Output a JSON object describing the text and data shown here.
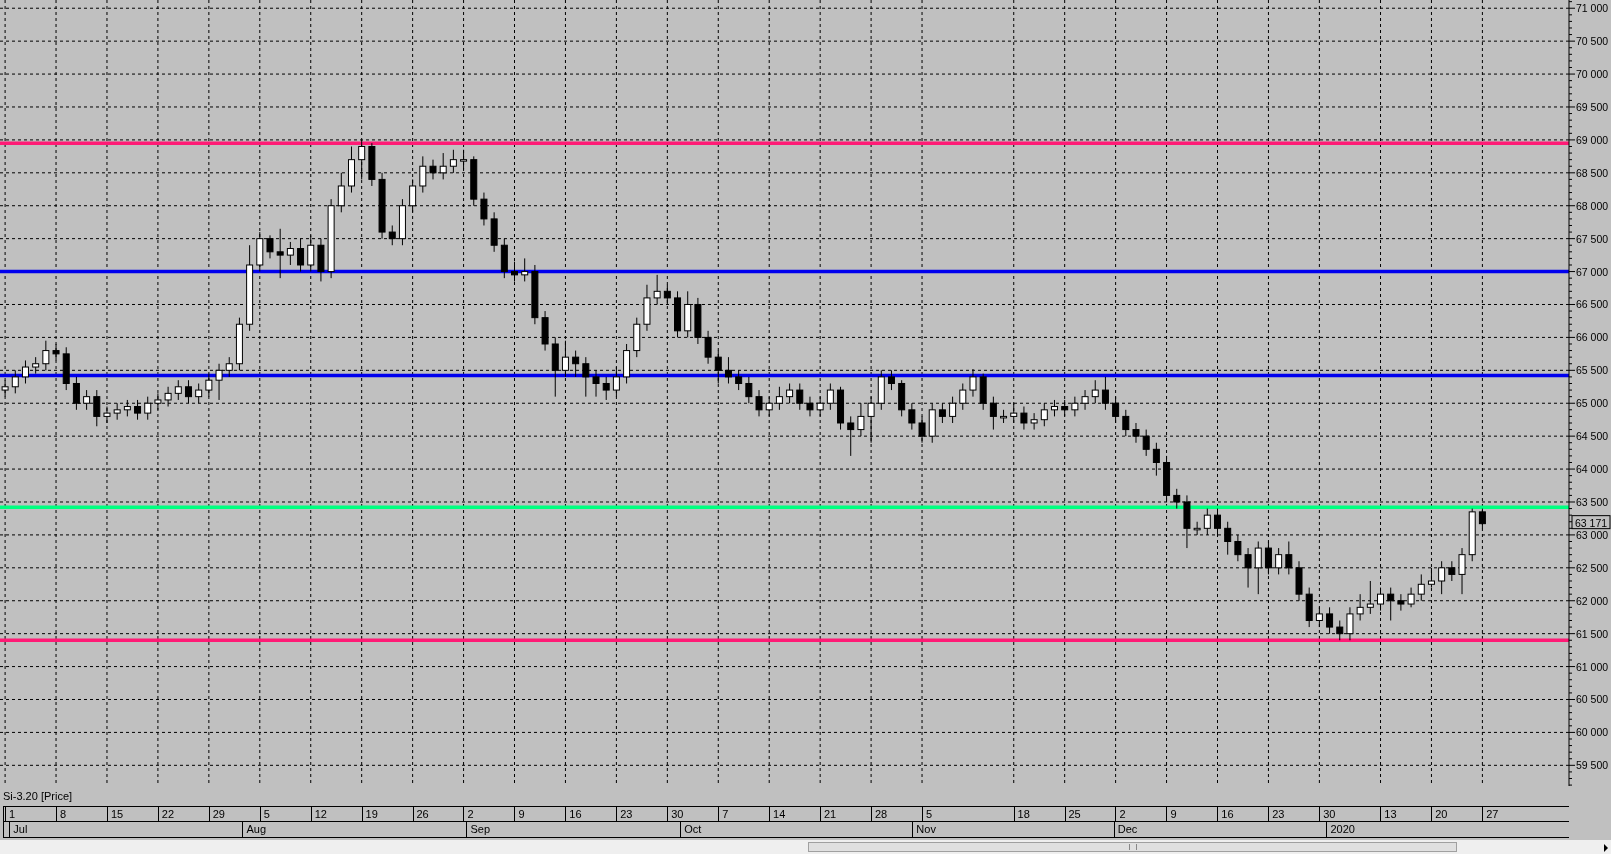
{
  "chart": {
    "chart_data": {
      "type": "candlestick",
      "categories": [
        null,
        null,
        null,
        null,
        null,
        null,
        null,
        null,
        null,
        null,
        null,
        null,
        null,
        null,
        null,
        null,
        null,
        null,
        null,
        null,
        null,
        null,
        null,
        null,
        null,
        null,
        null,
        null,
        null,
        null,
        null,
        null,
        null,
        null,
        null,
        null,
        null,
        null,
        null,
        null,
        null,
        null,
        null,
        null,
        null,
        null,
        null,
        null,
        null,
        null,
        null,
        null,
        null,
        null,
        null,
        null,
        null,
        null,
        null,
        null,
        null,
        null,
        null,
        null,
        null,
        null,
        null,
        null,
        null,
        null,
        null,
        null,
        null,
        null,
        null,
        null,
        null,
        null,
        null,
        null,
        null,
        null,
        null,
        null,
        null,
        null,
        null,
        null,
        null,
        null,
        null,
        null,
        null,
        null,
        null,
        null,
        null,
        null,
        null,
        null,
        null,
        null,
        null,
        null,
        null,
        null,
        null,
        null,
        null,
        null,
        null,
        null,
        null,
        null,
        null,
        null,
        null,
        null,
        null,
        null,
        null,
        null,
        null,
        null,
        null,
        null,
        null,
        null,
        null,
        null,
        null,
        null,
        null,
        null,
        null,
        null,
        null,
        null,
        null,
        null,
        null,
        null,
        null,
        null,
        null,
        null,
        null,
        null,
        null,
        null,
        null,
        null,
        null,
        null
      ],
      "ohlc": [
        [
          65200,
          65350,
          65100,
          65250
        ],
        [
          65250,
          65500,
          65150,
          65400
        ],
        [
          65400,
          65650,
          65300,
          65550
        ],
        [
          65550,
          65700,
          65450,
          65600
        ],
        [
          65600,
          65950,
          65500,
          65800
        ],
        [
          65800,
          65900,
          65650,
          65750
        ],
        [
          65750,
          65850,
          65200,
          65300
        ],
        [
          65300,
          65400,
          64900,
          65000
        ],
        [
          65000,
          65200,
          64900,
          65100
        ],
        [
          65100,
          65200,
          64650,
          64800
        ],
        [
          64800,
          64950,
          64700,
          64850
        ],
        [
          64850,
          65000,
          64750,
          64900
        ],
        [
          64900,
          65050,
          64800,
          64950
        ],
        [
          64950,
          65050,
          64750,
          64850
        ],
        [
          64850,
          65100,
          64750,
          65000
        ],
        [
          65000,
          65150,
          64900,
          65050
        ],
        [
          65050,
          65250,
          64950,
          65150
        ],
        [
          65150,
          65350,
          65050,
          65250
        ],
        [
          65250,
          65350,
          65000,
          65100
        ],
        [
          65100,
          65300,
          65000,
          65200
        ],
        [
          65200,
          65450,
          65100,
          65350
        ],
        [
          65350,
          65600,
          65050,
          65500
        ],
        [
          65500,
          65700,
          65400,
          65600
        ],
        [
          65600,
          66300,
          65500,
          66200
        ],
        [
          66200,
          67400,
          66100,
          67100
        ],
        [
          67100,
          67600,
          67000,
          67500
        ],
        [
          67500,
          67550,
          67200,
          67300
        ],
        [
          67300,
          67650,
          66900,
          67250
        ],
        [
          67250,
          67450,
          67100,
          67350
        ],
        [
          67350,
          67500,
          67000,
          67100
        ],
        [
          67100,
          67550,
          67000,
          67400
        ],
        [
          67400,
          67500,
          66850,
          67000
        ],
        [
          67000,
          68100,
          66900,
          68000
        ],
        [
          68000,
          68500,
          67900,
          68300
        ],
        [
          68300,
          68900,
          68200,
          68700
        ],
        [
          68700,
          69000,
          68400,
          68900
        ],
        [
          68900,
          68950,
          68300,
          68400
        ],
        [
          68400,
          68500,
          67500,
          67600
        ],
        [
          67600,
          67700,
          67400,
          67500
        ],
        [
          67500,
          68100,
          67400,
          68000
        ],
        [
          68000,
          68400,
          67900,
          68300
        ],
        [
          68300,
          68750,
          68200,
          68600
        ],
        [
          68600,
          68700,
          68400,
          68500
        ],
        [
          68500,
          68800,
          68400,
          68600
        ],
        [
          68600,
          68850,
          68500,
          68700
        ],
        [
          68700,
          68850,
          68550,
          68700
        ],
        [
          68700,
          68750,
          68000,
          68100
        ],
        [
          68100,
          68200,
          67700,
          67800
        ],
        [
          67800,
          67900,
          67300,
          67400
        ],
        [
          67400,
          67500,
          66900,
          67000
        ],
        [
          67000,
          67150,
          66850,
          66950
        ],
        [
          66950,
          67200,
          66850,
          67000
        ],
        [
          67000,
          67100,
          66200,
          66300
        ],
        [
          66300,
          66400,
          65800,
          65900
        ],
        [
          65900,
          66000,
          65100,
          65500
        ],
        [
          65500,
          65950,
          65400,
          65700
        ],
        [
          65700,
          65800,
          65400,
          65600
        ],
        [
          65600,
          65700,
          65100,
          65400
        ],
        [
          65400,
          65500,
          65100,
          65300
        ],
        [
          65300,
          65400,
          65050,
          65200
        ],
        [
          65200,
          65550,
          65100,
          65400
        ],
        [
          65400,
          65900,
          65300,
          65800
        ],
        [
          65800,
          66300,
          65700,
          66200
        ],
        [
          66200,
          66800,
          66100,
          66600
        ],
        [
          66600,
          66950,
          66500,
          66700
        ],
        [
          66700,
          66800,
          66500,
          66600
        ],
        [
          66600,
          66700,
          66000,
          66100
        ],
        [
          66100,
          66700,
          66000,
          66500
        ],
        [
          66500,
          66600,
          65900,
          66000
        ],
        [
          66000,
          66100,
          65600,
          65700
        ],
        [
          65700,
          65800,
          65300,
          65500
        ],
        [
          65500,
          65700,
          65300,
          65400
        ],
        [
          65400,
          65500,
          65200,
          65300
        ],
        [
          65300,
          65400,
          65000,
          65100
        ],
        [
          65100,
          65200,
          64800,
          64900
        ],
        [
          64900,
          65100,
          64800,
          65000
        ],
        [
          65000,
          65250,
          64900,
          65100
        ],
        [
          65100,
          65300,
          65000,
          65200
        ],
        [
          65200,
          65300,
          64900,
          65000
        ],
        [
          65000,
          65100,
          64800,
          64900
        ],
        [
          64900,
          65100,
          64800,
          65000
        ],
        [
          65000,
          65300,
          64900,
          65200
        ],
        [
          65200,
          65250,
          64600,
          64700
        ],
        [
          64700,
          64800,
          64200,
          64600
        ],
        [
          64600,
          65000,
          64500,
          64800
        ],
        [
          64800,
          65100,
          64400,
          65000
        ],
        [
          65000,
          65500,
          64900,
          65400
        ],
        [
          65400,
          65500,
          65200,
          65300
        ],
        [
          65300,
          65350,
          64800,
          64900
        ],
        [
          64900,
          65000,
          64600,
          64700
        ],
        [
          64700,
          64800,
          64400,
          64500
        ],
        [
          64500,
          65000,
          64400,
          64900
        ],
        [
          64900,
          65000,
          64700,
          64800
        ],
        [
          64800,
          65100,
          64700,
          65000
        ],
        [
          65000,
          65300,
          64900,
          65200
        ],
        [
          65200,
          65520,
          65100,
          65400
        ],
        [
          65400,
          65450,
          64900,
          65000
        ],
        [
          65000,
          65100,
          64600,
          64800
        ],
        [
          64800,
          64900,
          64700,
          64800
        ],
        [
          64800,
          65000,
          64700,
          64850
        ],
        [
          64850,
          64950,
          64600,
          64700
        ],
        [
          64700,
          64850,
          64600,
          64750
        ],
        [
          64750,
          65000,
          64650,
          64900
        ],
        [
          64900,
          65050,
          64800,
          64950
        ],
        [
          64950,
          65050,
          64800,
          64900
        ],
        [
          64900,
          65100,
          64800,
          65000
        ],
        [
          65000,
          65200,
          64900,
          65100
        ],
        [
          65100,
          65350,
          65000,
          65200
        ],
        [
          65200,
          65400,
          64900,
          65000
        ],
        [
          65000,
          65100,
          64700,
          64800
        ],
        [
          64800,
          64900,
          64500,
          64600
        ],
        [
          64600,
          64700,
          64400,
          64500
        ],
        [
          64500,
          64600,
          64200,
          64300
        ],
        [
          64300,
          64400,
          63900,
          64100
        ],
        [
          64100,
          64200,
          63500,
          63600
        ],
        [
          63600,
          63700,
          63400,
          63500
        ],
        [
          63500,
          63600,
          62800,
          63100
        ],
        [
          63100,
          63200,
          63000,
          63100
        ],
        [
          63100,
          63400,
          63000,
          63300
        ],
        [
          63300,
          63400,
          63000,
          63100
        ],
        [
          63100,
          63200,
          62700,
          62900
        ],
        [
          62900,
          63000,
          62600,
          62700
        ],
        [
          62700,
          62800,
          62200,
          62500
        ],
        [
          62500,
          62900,
          62100,
          62800
        ],
        [
          62800,
          62900,
          62400,
          62500
        ],
        [
          62500,
          62800,
          62400,
          62700
        ],
        [
          62700,
          62900,
          62400,
          62500
        ],
        [
          62500,
          62600,
          62000,
          62100
        ],
        [
          62100,
          62200,
          61600,
          61700
        ],
        [
          61700,
          61900,
          61600,
          61800
        ],
        [
          61800,
          61900,
          61500,
          61600
        ],
        [
          61600,
          61700,
          61400,
          61500
        ],
        [
          61500,
          61900,
          61400,
          61800
        ],
        [
          61800,
          62100,
          61700,
          61900
        ],
        [
          61900,
          62300,
          61800,
          61950
        ],
        [
          61950,
          62200,
          61850,
          62100
        ],
        [
          62100,
          62200,
          61700,
          62000
        ],
        [
          62000,
          62100,
          61850,
          61950
        ],
        [
          61950,
          62200,
          61900,
          62100
        ],
        [
          62100,
          62400,
          62000,
          62250
        ],
        [
          62250,
          62500,
          62200,
          62300
        ],
        [
          62300,
          62600,
          62100,
          62500
        ],
        [
          62500,
          62600,
          62300,
          62400
        ],
        [
          62400,
          62800,
          62100,
          62700
        ],
        [
          62700,
          63400,
          62600,
          63350
        ],
        [
          63350,
          63400,
          63100,
          63171
        ],
        null,
        null,
        null,
        null,
        null,
        null,
        null,
        null
      ],
      "ylim": [
        59186,
        71125
      ],
      "grid": true,
      "yticks": [
        {
          "value": 71000,
          "label": "71 000"
        },
        {
          "value": 70500,
          "label": "70 500"
        },
        {
          "value": 70000,
          "label": "70 000"
        },
        {
          "value": 69500,
          "label": "69 500"
        },
        {
          "value": 69000,
          "label": "69 000"
        },
        {
          "value": 68500,
          "label": "68 500"
        },
        {
          "value": 68000,
          "label": "68 000"
        },
        {
          "value": 67500,
          "label": "67 500"
        },
        {
          "value": 67000,
          "label": "67 000"
        },
        {
          "value": 66500,
          "label": "66 500"
        },
        {
          "value": 66000,
          "label": "66 000"
        },
        {
          "value": 65500,
          "label": "65 500"
        },
        {
          "value": 65000,
          "label": "65 000"
        },
        {
          "value": 64500,
          "label": "64 500"
        },
        {
          "value": 64000,
          "label": "64 000"
        },
        {
          "value": 63500,
          "label": "63 500"
        },
        {
          "value": 63000,
          "label": "63 000"
        },
        {
          "value": 62500,
          "label": "62 500"
        },
        {
          "value": 62000,
          "label": "62 000"
        },
        {
          "value": 61500,
          "label": "61 500"
        },
        {
          "value": 61000,
          "label": "61 000"
        },
        {
          "value": 60500,
          "label": "60 500"
        },
        {
          "value": 60000,
          "label": "60 000"
        },
        {
          "value": 59500,
          "label": "59 500"
        }
      ],
      "ref_lines": [
        {
          "axis": "y",
          "value": 68950,
          "color": "#ff1a75"
        },
        {
          "axis": "y",
          "value": 67000,
          "color": "#0000ee"
        },
        {
          "axis": "y",
          "value": 65420,
          "color": "#0000ee"
        },
        {
          "axis": "y",
          "value": 63420,
          "color": "#00ff80"
        },
        {
          "axis": "y",
          "value": 61400,
          "color": "#ff1a75"
        }
      ]
    },
    "days": [
      "1",
      "8",
      "15",
      "22",
      "29",
      "5",
      "12",
      "19",
      "26",
      "2",
      "9",
      "16",
      "23",
      "30",
      "7",
      "14",
      "21",
      "28",
      "5",
      "18",
      "25",
      "2",
      "9",
      "16",
      "23",
      "30",
      "13",
      "20",
      "27"
    ],
    "last_price": "63 171",
    "series_label": "Si-3.20 [Price]",
    "months": [
      "Jul",
      "Aug",
      "Sep",
      "Oct",
      "Nov",
      "Dec",
      "2020"
    ]
  }
}
